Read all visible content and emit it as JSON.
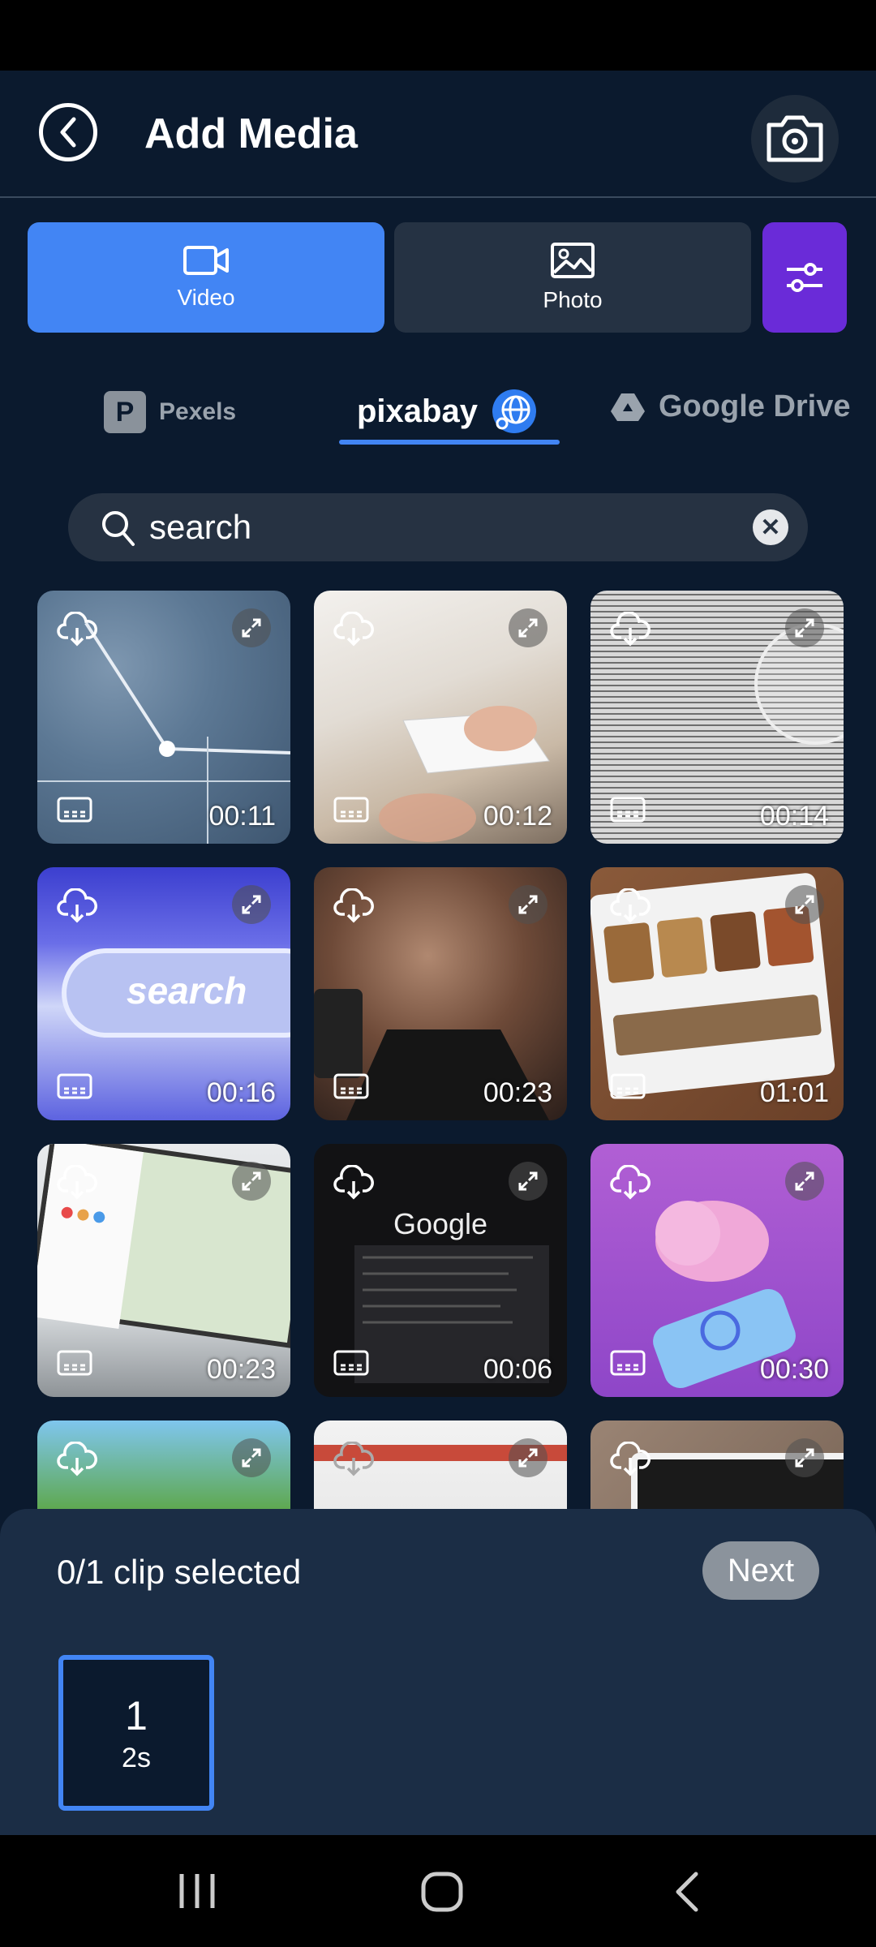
{
  "header": {
    "title": "Add Media"
  },
  "media_types": [
    {
      "label": "Video",
      "active": true
    },
    {
      "label": "Photo",
      "active": false
    }
  ],
  "sources": [
    {
      "label": "Pexels",
      "active": false
    },
    {
      "label": "pixabay",
      "active": true
    },
    {
      "label": "Google Drive",
      "active": false
    }
  ],
  "search": {
    "value": "search"
  },
  "tiles": [
    {
      "duration": "00:11",
      "theme": "globe-lines"
    },
    {
      "duration": "00:12",
      "theme": "typing-keyboard"
    },
    {
      "duration": "00:14",
      "theme": "dictionary-page"
    },
    {
      "duration": "00:16",
      "theme": "search-bar-cursor"
    },
    {
      "duration": "00:23",
      "theme": "man-with-phone"
    },
    {
      "duration": "01:01",
      "theme": "tablet-food-photos"
    },
    {
      "duration": "00:23",
      "theme": "laptop-map"
    },
    {
      "duration": "00:06",
      "theme": "google-search-screen"
    },
    {
      "duration": "00:30",
      "theme": "cloud-phone-illustration"
    },
    {
      "duration": "",
      "theme": "trees-cartoon"
    },
    {
      "duration": "",
      "theme": "browser-screenshot"
    },
    {
      "duration": "",
      "theme": "tablet-on-wood"
    }
  ],
  "selection": {
    "status": "0/1 clip selected",
    "next_label": "Next"
  },
  "clip": {
    "number": "1",
    "duration": "2s"
  }
}
